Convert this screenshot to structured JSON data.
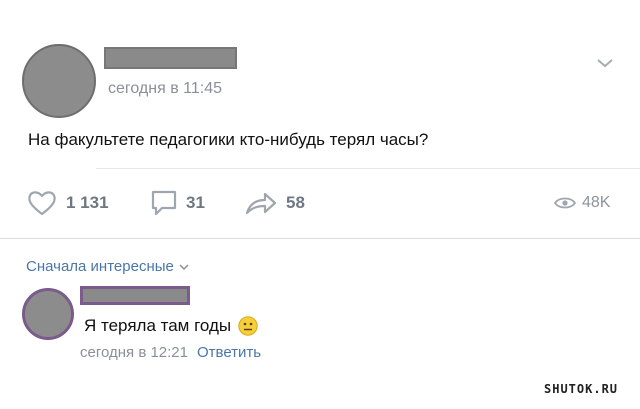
{
  "post": {
    "time": "сегодня в 11:45",
    "text": "На факультете педагогики кто-нибудь терял часы?"
  },
  "actions": {
    "likes": "1 131",
    "comments": "31",
    "shares": "58",
    "views": "48K"
  },
  "comments_section": {
    "sort_label": "Сначала интересные",
    "comment": {
      "text": "Я теряла там годы",
      "time": "сегодня в 12:21",
      "reply_label": "Ответить"
    }
  },
  "watermark": "SHUTOK.RU",
  "colors": {
    "link": "#4a76a8",
    "muted": "#8a9099",
    "icon": "#a0a6ae",
    "redaction_border": "#7a5b8c"
  }
}
